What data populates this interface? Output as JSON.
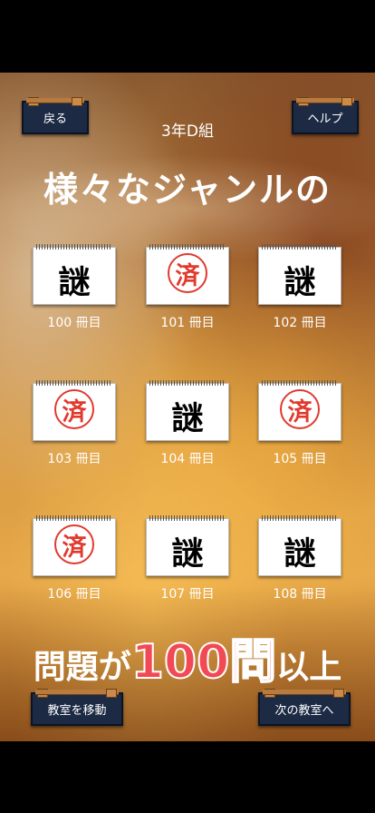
{
  "header": {
    "back_label": "戻る",
    "help_label": "ヘルプ",
    "class_name": "3年D組"
  },
  "headline": "様々なジャンルの",
  "books": [
    {
      "label": "100 冊目",
      "state": "謎"
    },
    {
      "label": "101 冊目",
      "state": "済"
    },
    {
      "label": "102 冊目",
      "state": "謎"
    },
    {
      "label": "103 冊目",
      "state": "済"
    },
    {
      "label": "104 冊目",
      "state": "謎"
    },
    {
      "label": "105 冊目",
      "state": "済"
    },
    {
      "label": "106 冊目",
      "state": "済"
    },
    {
      "label": "107 冊目",
      "state": "謎"
    },
    {
      "label": "108 冊目",
      "state": "謎"
    }
  ],
  "footline": {
    "pre": "問題が",
    "big": "100問",
    "post": "以上"
  },
  "footer": {
    "move_label": "教室を移動",
    "next_label": "次の教室へ"
  },
  "colors": {
    "accent_red": "#f24a55",
    "stamp_red": "#e03a2e",
    "button_navy": "#1c2a44"
  }
}
